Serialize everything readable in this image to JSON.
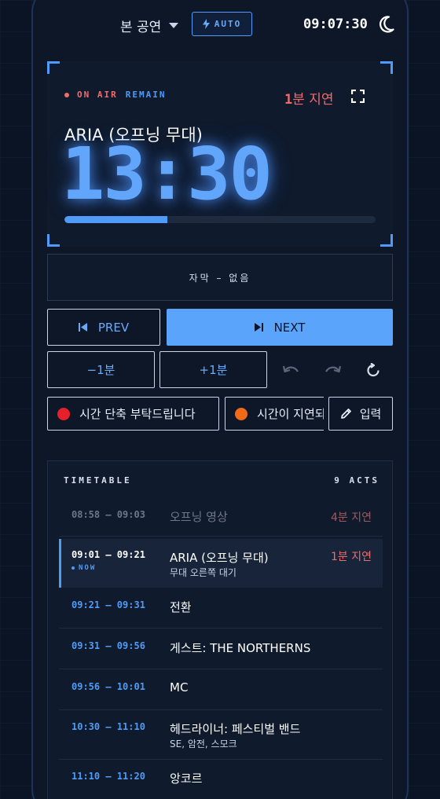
{
  "header": {
    "show_label": "본 공연",
    "auto_label": "AUTO",
    "clock": "09:07:30",
    "theme_icon": "moon-icon"
  },
  "hero": {
    "status_on_air": "ON AIR",
    "status_remain": "REMAIN",
    "delay_num": "1",
    "delay_text": "분 지연",
    "act_title": "ARIA (오프닝 무대)",
    "remaining": "13:30",
    "progress": 0.33
  },
  "subtitle": {
    "text": "자막 – 없음"
  },
  "nav": {
    "prev_label": "PREV",
    "next_label": "NEXT",
    "minus_label": "−1분",
    "plus_label": "+1분"
  },
  "messages": {
    "items": [
      {
        "label": "시간 단축 부탁드립니다",
        "color": "#e5202a"
      },
      {
        "label": "시간이 지연되고 있습니다",
        "color": "#f06a17"
      }
    ],
    "input_label": "입력"
  },
  "timetable": {
    "title": "TIMETABLE",
    "count": "9 ACTS",
    "now_label": "NOW",
    "rows": [
      {
        "time": "08:58 – 09:03",
        "name": "오프닝 영상",
        "sub": "",
        "delay": "4분 지연",
        "state": "past"
      },
      {
        "time": "09:01 – 09:21",
        "name": "ARIA (오프닝 무대)",
        "sub": "무대 오른쪽 대기",
        "delay": "1분 지연",
        "state": "current"
      },
      {
        "time": "09:21 – 09:31",
        "name": "전환",
        "sub": "",
        "delay": "",
        "state": "upcoming"
      },
      {
        "time": "09:31 – 09:56",
        "name": "게스트: THE NORTHERNS",
        "sub": "",
        "delay": "",
        "state": "upcoming"
      },
      {
        "time": "09:56 – 10:01",
        "name": "MC",
        "sub": "",
        "delay": "",
        "state": "upcoming"
      },
      {
        "time": "10:30 – 11:10",
        "name": "헤드라이너: 페스티벌 밴드",
        "sub": "SE, 암전, 스모크",
        "delay": "",
        "state": "upcoming"
      },
      {
        "time": "11:10 – 11:20",
        "name": "앙코르",
        "sub": "",
        "delay": "",
        "state": "upcoming"
      }
    ]
  }
}
